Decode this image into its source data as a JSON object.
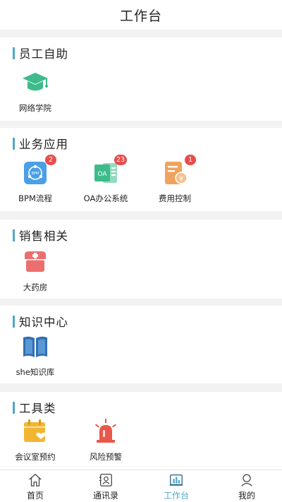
{
  "header": {
    "title": "工作台"
  },
  "sections": [
    {
      "title": "员工自助",
      "items": [
        {
          "label": "网络学院",
          "icon": "graduation-cap-icon"
        }
      ]
    },
    {
      "title": "业务应用",
      "items": [
        {
          "label": "BPM流程",
          "icon": "bpm-flow-icon",
          "badge": "2"
        },
        {
          "label": "OA办公系统",
          "icon": "oa-icon",
          "badge": "23"
        },
        {
          "label": "费用控制",
          "icon": "expense-icon",
          "badge": "1"
        }
      ]
    },
    {
      "title": "销售相关",
      "items": [
        {
          "label": "大药房",
          "icon": "pharmacy-icon"
        }
      ]
    },
    {
      "title": "知识中心",
      "items": [
        {
          "label": "she知识库",
          "icon": "book-icon"
        }
      ]
    },
    {
      "title": "工具类",
      "items": [
        {
          "label": "会议室预约",
          "icon": "calendar-icon"
        },
        {
          "label": "风险预警",
          "icon": "alarm-icon"
        }
      ]
    }
  ],
  "tabbar": {
    "tabs": [
      {
        "label": "首页",
        "icon": "home-icon"
      },
      {
        "label": "通讯录",
        "icon": "contacts-icon"
      },
      {
        "label": "工作台",
        "icon": "workbench-icon",
        "active": true
      },
      {
        "label": "我的",
        "icon": "user-icon"
      }
    ]
  },
  "colors": {
    "accent": "#4fa7c5",
    "badge": "#e84c4c",
    "background": "#f2f2f2"
  }
}
